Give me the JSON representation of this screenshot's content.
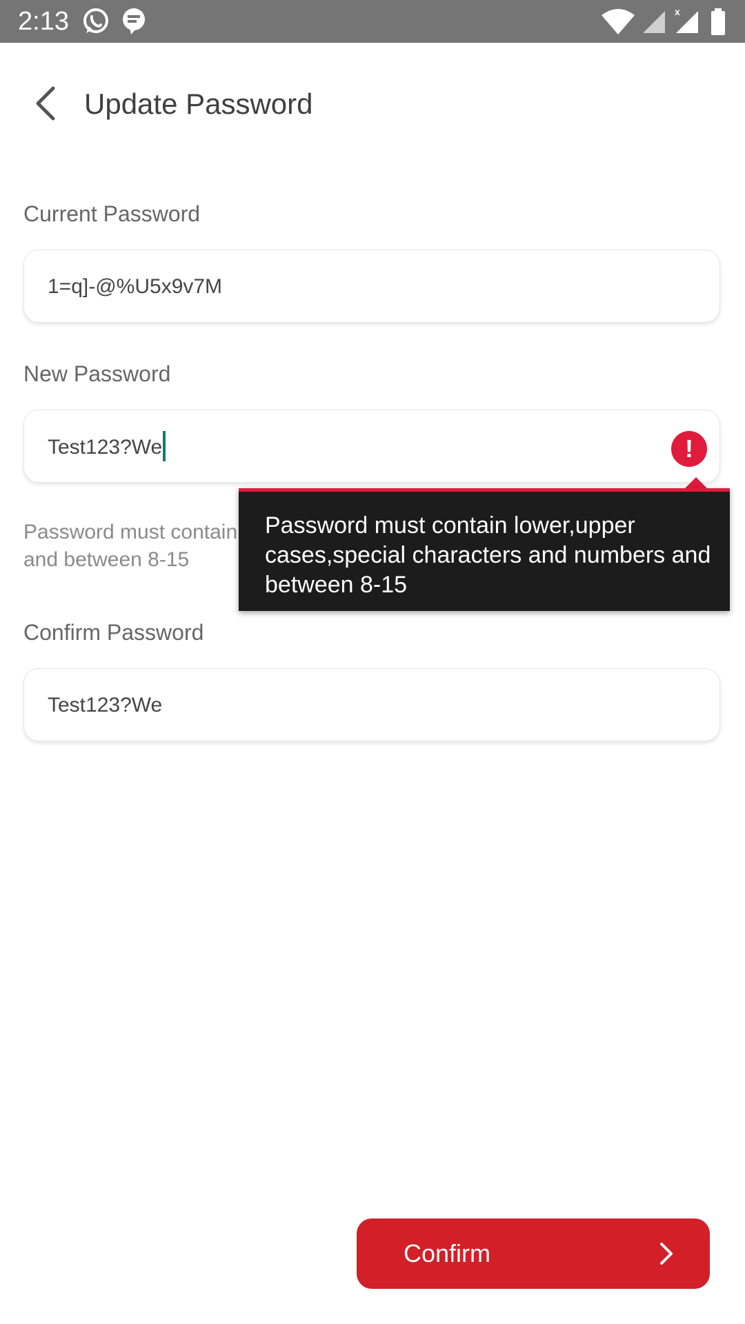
{
  "status_bar": {
    "time": "2:13",
    "icons": [
      "whatsapp-icon",
      "chat-bubble-icon",
      "wifi-icon",
      "signal-icon",
      "signal-no-service-icon",
      "battery-icon"
    ]
  },
  "header": {
    "title": "Update Password",
    "back_icon": "chevron-left-icon"
  },
  "form": {
    "current_password": {
      "label": "Current Password",
      "value": "1=q]-@%U5x9v7M"
    },
    "new_password": {
      "label": "New Password",
      "value": "Test123?We",
      "error_icon": "exclamation-icon",
      "hint": "Password must contain lower,upper cases,special characters and numbers and between 8-15"
    },
    "confirm_password": {
      "label": "Confirm Password",
      "value": "Test123?We"
    }
  },
  "tooltip": {
    "text": "Password must contain lower,upper cases,special characters and numbers and between 8-15"
  },
  "actions": {
    "confirm_label": "Confirm",
    "confirm_icon": "chevron-right-icon"
  },
  "colors": {
    "accent_red": "#d21f28",
    "error_red": "#e01b3c",
    "caret_teal": "#0d7d6c",
    "status_bar": "#757575",
    "tooltip_bg": "#1c1c1c"
  }
}
